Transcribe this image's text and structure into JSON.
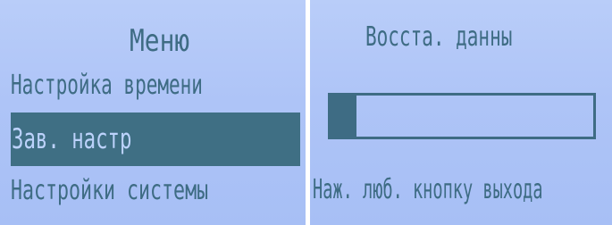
{
  "menu_screen": {
    "title": "Меню",
    "items": [
      {
        "label": "Настройка времени",
        "selected": false
      },
      {
        "label": "Зав. настр",
        "selected": true
      },
      {
        "label": "Настройки системы",
        "selected": false
      }
    ]
  },
  "restore_screen": {
    "title": "Восста. данны",
    "progress": 0.1,
    "hint": "Наж. люб. кнопку выхода"
  },
  "colors": {
    "lcd_background": "#aec4f7",
    "lcd_text": "#3e6c84",
    "selection_bar": "#3f6f84"
  }
}
